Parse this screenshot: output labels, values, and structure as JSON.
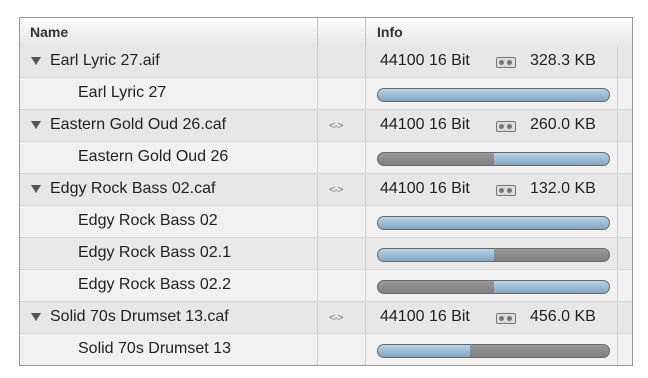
{
  "header": {
    "name": "Name",
    "info": "Info"
  },
  "rows": [
    {
      "type": "file",
      "name": "Earl Lyric 27.aif",
      "link": "",
      "info": "44100 16 Bit",
      "channel_icon": "mono-icon",
      "size": "328.3 KB"
    },
    {
      "type": "region",
      "name": "Earl Lyric 27",
      "selection": {
        "start": 0.0,
        "end": 1.0
      }
    },
    {
      "type": "file",
      "name": "Eastern Gold Oud 26.caf",
      "link": "<->",
      "info": "44100 16 Bit",
      "channel_icon": "stereo-icon",
      "size": "260.0 KB"
    },
    {
      "type": "region",
      "name": "Eastern Gold Oud 26",
      "selection": {
        "start": 0.5,
        "end": 1.0
      }
    },
    {
      "type": "file",
      "name": "Edgy Rock Bass 02.caf",
      "link": "<->",
      "info": "44100 16 Bit",
      "channel_icon": "stereo-icon",
      "size": "132.0 KB"
    },
    {
      "type": "region",
      "name": "Edgy Rock Bass 02",
      "selection": {
        "start": 0.0,
        "end": 1.0
      }
    },
    {
      "type": "region",
      "name": "Edgy Rock Bass 02.1",
      "selection": {
        "start": 0.0,
        "end": 0.5
      }
    },
    {
      "type": "region",
      "name": "Edgy Rock Bass 02.2",
      "selection": {
        "start": 0.5,
        "end": 1.0
      }
    },
    {
      "type": "file",
      "name": "Solid 70s Drumset 13.caf",
      "link": "<->",
      "info": "44100 16 Bit",
      "channel_icon": "stereo-icon",
      "size": "456.0 KB"
    },
    {
      "type": "region",
      "name": "Solid 70s Drumset 13",
      "selection": {
        "start": 0.0,
        "end": 0.4
      }
    }
  ]
}
